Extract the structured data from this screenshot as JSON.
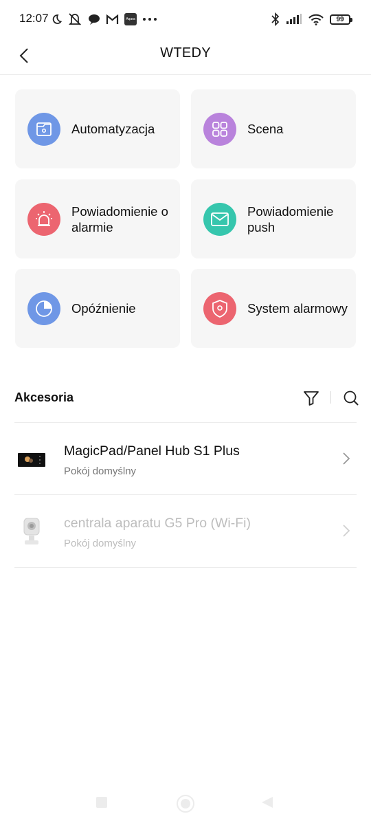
{
  "status_bar": {
    "time": "12:07",
    "battery": "99",
    "left_icons": [
      "moon-icon",
      "mute-icon",
      "chat-icon",
      "gmail-icon",
      "app-icon",
      "more-dots-icon"
    ],
    "right_icons": [
      "bluetooth-icon",
      "signal-icon",
      "wifi-icon",
      "battery-icon"
    ],
    "app_badge_text": "Aqara"
  },
  "header": {
    "title": "WTEDY"
  },
  "actions": [
    {
      "label": "Automatyzacja",
      "icon": "automation-icon",
      "color": "#6f97e6"
    },
    {
      "label": "Scena",
      "icon": "scene-icon",
      "color": "#b983dc"
    },
    {
      "label": "Powiadomienie o alarmie",
      "icon": "alarm-light-icon",
      "color": "#ec6570"
    },
    {
      "label": "Powiadomienie push",
      "icon": "mail-icon",
      "color": "#36c6ad"
    },
    {
      "label": "Opóźnienie",
      "icon": "timer-icon",
      "color": "#6f97e6"
    },
    {
      "label": "System alarmowy",
      "icon": "shield-icon",
      "color": "#ec6570"
    }
  ],
  "accessories": {
    "title": "Akcesoria",
    "devices": [
      {
        "name": "MagicPad/Panel Hub S1 Plus",
        "room": "Pokój domyślny",
        "online": true
      },
      {
        "name": "centrala aparatu G5 Pro (Wi-Fi)",
        "room": "Pokój domyślny",
        "online": false
      }
    ]
  },
  "colors": {
    "card_bg": "#f6f6f6",
    "text_primary": "#111111",
    "text_secondary": "#777777",
    "text_disabled": "#bdbdbd"
  }
}
